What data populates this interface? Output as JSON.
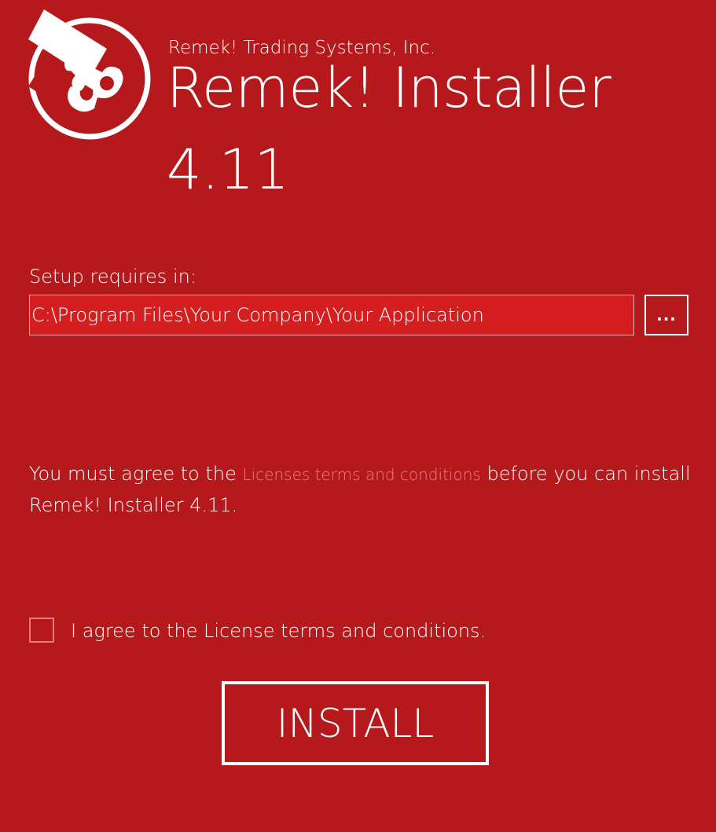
{
  "app": {
    "company": "Remek! Trading Systems, Inc.",
    "title": "Remek! Installer",
    "version": "4.11",
    "logo_icon": "puzzle-piece-logo-icon"
  },
  "install_path": {
    "label": "Setup requires in:",
    "value": "C:\\Program Files\\Your Company\\Your Application",
    "browse_label": "..."
  },
  "license": {
    "prefix": "You must agree to the ",
    "link_text": "Licenses terms and conditions",
    "suffix": " before you can install Remek! Installer 4.11.",
    "checkbox_label": "I agree to the License terms and conditions.",
    "checked": false
  },
  "actions": {
    "install_label": "INSTALL"
  },
  "colors": {
    "background": "#b5191b",
    "input_background": "#d41e20",
    "link": "#f27c8a",
    "text": "#ffffff"
  }
}
